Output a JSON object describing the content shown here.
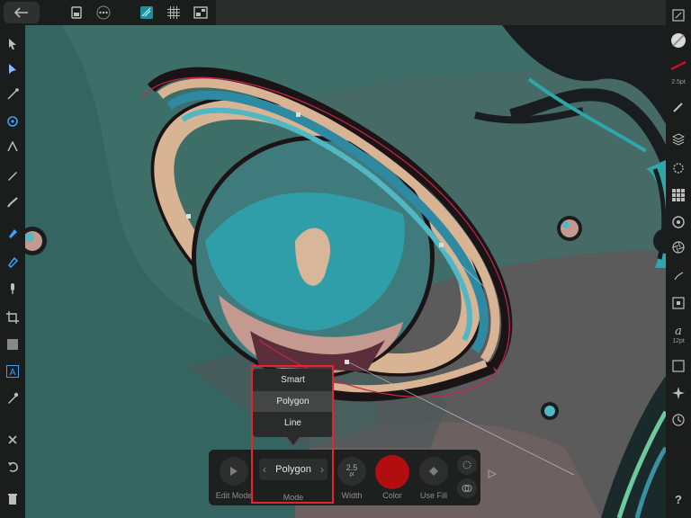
{
  "toolbar": {
    "icons": [
      "back-arrow-icon",
      "document-icon",
      "more-icon",
      "snap-icon",
      "grid-icon",
      "view-icon"
    ]
  },
  "left_tools": [
    "move-tool-icon",
    "node-tool-icon",
    "corner-tool-icon",
    "point-transform-icon",
    "contour-tool-icon",
    "pencil-tool-icon",
    "vector-brush-icon",
    "pen-tool-icon",
    "fill-tool-icon",
    "transparency-tool-icon",
    "crop-tool-icon",
    "shape-tool-icon",
    "text-tool-icon",
    "color-picker-icon",
    "delete-icon",
    "undo-icon",
    "trash-icon"
  ],
  "right_studio": {
    "stroke_width_label": "2.5pt",
    "font_size_label": "12pt",
    "help_label": "?"
  },
  "context_toolbar": {
    "edit_mode_label": "Edit Mode",
    "mode_value": "Polygon",
    "mode_label": "Mode",
    "width_value": "2.5",
    "width_unit": "pt",
    "width_label": "Width",
    "color_label": "Color",
    "color_value": "#b20d0f",
    "use_fill_label": "Use Fill"
  },
  "mode_popup": {
    "options": [
      "Smart",
      "Polygon",
      "Line"
    ],
    "selected": "Polygon"
  },
  "colors": {
    "canvas_teal": "#3b6e67",
    "accent_cyan": "#36c9d8",
    "stroke_red": "#b20d0f",
    "highlight": "#e8232c"
  }
}
